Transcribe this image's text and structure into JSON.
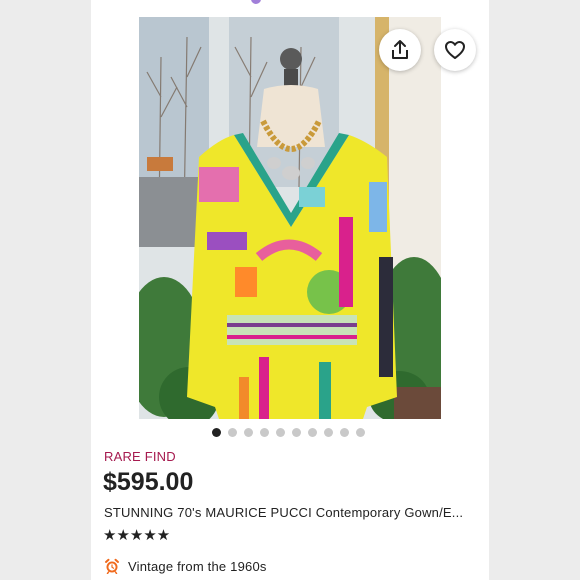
{
  "listing": {
    "badge": "RARE FIND",
    "price": "$595.00",
    "title": "STUNNING 70's MAURICE PUCCI Contemporary Gown/E...",
    "rating_stars": "★★★★★",
    "vintage_label": "Vintage from the 1960s"
  },
  "gallery": {
    "image_count": 10,
    "active_index": 0
  },
  "icons": {
    "share": "share-icon",
    "favorite": "heart-icon",
    "vintage": "alarm-clock-icon"
  },
  "colors": {
    "badge": "#a61a4f",
    "text": "#222222",
    "dot_active": "#222222",
    "dot_inactive": "#c9c9c9",
    "vintage_icon": "#f06a1d"
  }
}
